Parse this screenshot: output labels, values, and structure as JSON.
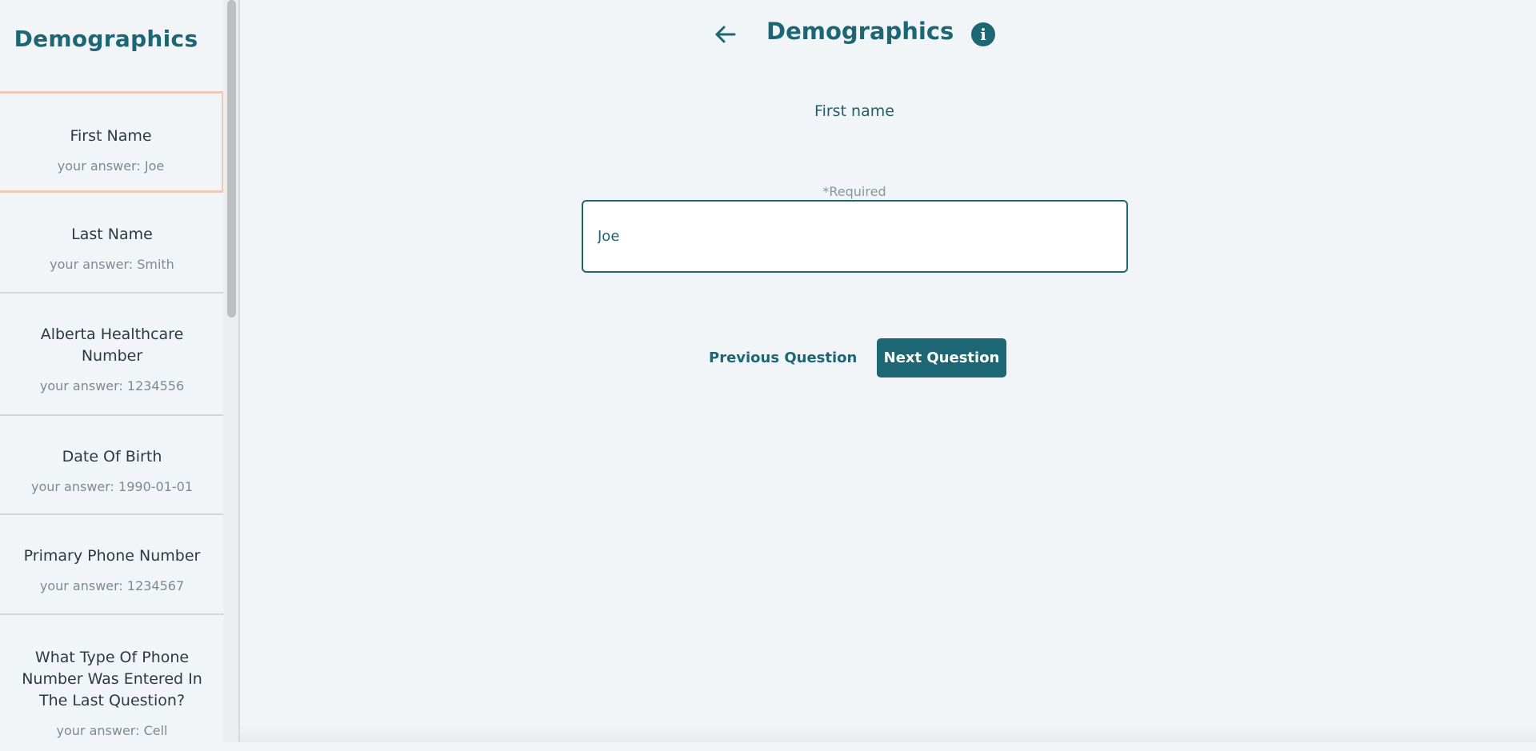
{
  "sidebar": {
    "title": "Demographics",
    "items": [
      {
        "label": "First Name",
        "answer": "your answer: Joe",
        "active": true
      },
      {
        "label": "Last Name",
        "answer": "your answer: Smith"
      },
      {
        "label": "Alberta Healthcare Number",
        "answer": "your answer: 1234556"
      },
      {
        "label": "Date Of Birth",
        "answer": "your answer: 1990-01-01"
      },
      {
        "label": "Primary Phone Number",
        "answer": "your answer: 1234567"
      },
      {
        "label": "What Type Of Phone Number Was Entered In The Last Question?",
        "answer": "your answer: Cell"
      }
    ]
  },
  "header": {
    "title": "Demographics",
    "back_icon": "arrow-left-icon",
    "info_icon": "info-icon",
    "info_glyph": "i"
  },
  "question": {
    "text": "First name",
    "required_label": "*Required",
    "answer_value": "Joe"
  },
  "nav": {
    "previous_label": "Previous Question",
    "next_label": "Next Question"
  },
  "colors": {
    "brand": "#1d6775",
    "active_border": "#f2c9b6",
    "background": "#f2f5f7"
  }
}
